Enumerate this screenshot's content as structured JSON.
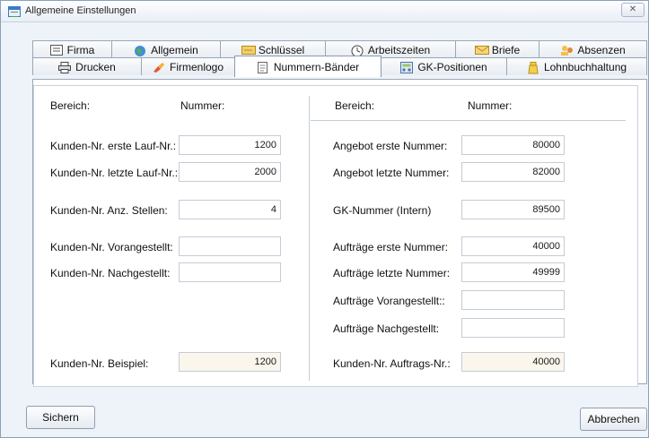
{
  "window": {
    "title": "Allgemeine Einstellungen",
    "close_glyph": "✕"
  },
  "tabs_row1": [
    {
      "label": "Firma",
      "icon": "form-icon"
    },
    {
      "label": "Allgemein",
      "icon": "globe-icon"
    },
    {
      "label": "Schlüssel",
      "icon": "key-card-icon"
    },
    {
      "label": "Arbeitszeiten",
      "icon": "clock-icon"
    },
    {
      "label": "Briefe",
      "icon": "envelope-icon"
    },
    {
      "label": "Absenzen",
      "icon": "people-icon"
    }
  ],
  "tabs_row2": [
    {
      "label": "Drucken",
      "icon": "printer-icon"
    },
    {
      "label": "Firmenlogo",
      "icon": "paint-icon"
    },
    {
      "label": "Nummern-Bänder",
      "icon": "document-numbers-icon",
      "active": true
    },
    {
      "label": "GK-Positionen",
      "icon": "calculator-icon"
    },
    {
      "label": "Lohnbuchhaltung",
      "icon": "money-icon"
    }
  ],
  "left": {
    "header_area": "Bereich:",
    "header_number": "Nummer:",
    "rows": [
      {
        "label": "Kunden-Nr. erste Lauf-Nr.:",
        "value": "1200"
      },
      {
        "label": "Kunden-Nr. letzte Lauf-Nr.:",
        "value": "2000"
      },
      {
        "label": "Kunden-Nr. Anz. Stellen:",
        "value": "4"
      },
      {
        "label": "Kunden-Nr. Vorangestellt:",
        "value": ""
      },
      {
        "label": "Kunden-Nr. Nachgestellt:",
        "value": ""
      },
      {
        "label": "Kunden-Nr. Beispiel:",
        "value": "1200"
      }
    ]
  },
  "right": {
    "header_area": "Bereich:",
    "header_number": "Nummer:",
    "rows": [
      {
        "label": "Angebot erste Nummer:",
        "value": "80000"
      },
      {
        "label": "Angebot letzte Nummer:",
        "value": "82000"
      },
      {
        "label": "GK-Nummer (Intern)",
        "value": "89500"
      },
      {
        "label": "Aufträge erste Nummer:",
        "value": "40000"
      },
      {
        "label": "Aufträge letzte Nummer:",
        "value": "49999"
      },
      {
        "label": "Aufträge Vorangestellt::",
        "value": ""
      },
      {
        "label": "Aufträge Nachgestellt:",
        "value": ""
      },
      {
        "label": "Kunden-Nr. Auftrags-Nr.:",
        "value": "40000"
      }
    ]
  },
  "buttons": {
    "save": "Sichern",
    "cancel": "Abbrechen"
  },
  "colors": {
    "readonly_field": "#fbf6ec",
    "window_bg": "#eef3f9",
    "accent": "#3b79c4"
  }
}
